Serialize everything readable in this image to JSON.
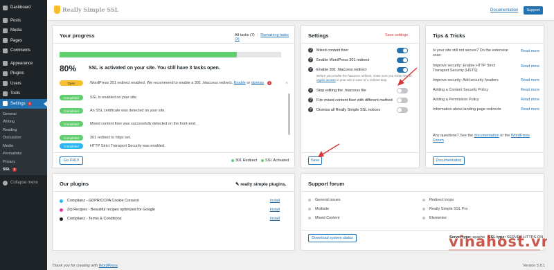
{
  "sidebar": {
    "items": [
      {
        "label": "Dashboard"
      },
      {
        "label": "Posts"
      },
      {
        "label": "Media"
      },
      {
        "label": "Pages"
      },
      {
        "label": "Comments"
      },
      {
        "label": "Appearance"
      },
      {
        "label": "Plugins"
      },
      {
        "label": "Users"
      },
      {
        "label": "Tools"
      }
    ],
    "settings": {
      "label": "Settings",
      "badge": "1"
    },
    "submenu": [
      "General",
      "Writing",
      "Reading",
      "Discussion",
      "Media",
      "Permalinks",
      "Privacy"
    ],
    "ssl": {
      "label": "SSL",
      "badge": "1"
    },
    "collapse": "Collapse menu"
  },
  "header": {
    "logo": "Really Simple SSL",
    "documentation": "Documentation",
    "support": "Support"
  },
  "progress": {
    "title": "Your progress",
    "filter_all": "All tasks (7)",
    "filter_remaining": "Remaining tasks (3)",
    "percent_value": 0.8,
    "percent_label": "80%",
    "status": "SSL is activated on your site. You still have 3 tasks open.",
    "tasks": [
      {
        "status": "Open",
        "pre": "WordPress 301 redirect enabled. We recommend to enable a 301 .htaccess redirect.",
        "link1": "Enable",
        "mid": "or",
        "link2": "dismiss",
        "badge": "1"
      },
      {
        "status": "Completed",
        "text": "SSL is enabled on your site."
      },
      {
        "status": "Completed",
        "text": "An SSL certificate was detected on your site."
      },
      {
        "status": "Completed",
        "text": "Mixed content fixer was successfully detected on the front-end."
      },
      {
        "status": "Completed",
        "text": "301 redirect to https set."
      },
      {
        "status": "Completed",
        "text": "HTTP Strict Transport Security was enabled."
      }
    ],
    "go_pro": "Go PRO!",
    "legend_redirect": "301 Redirect",
    "legend_ssl": "SSL Activated"
  },
  "settings": {
    "title": "Settings",
    "save_link": "Save settings",
    "rows": [
      {
        "label": "Mixed content fixer",
        "on": true
      },
      {
        "label": "Enable WordPress 301 redirect",
        "on": true
      },
      {
        "label": "Enable 301 .htaccess redirect",
        "on": true
      },
      {
        "label": "Stop editing the .htaccess file",
        "on": false
      },
      {
        "label": "Fire mixed content fixer with different method",
        "on": false
      },
      {
        "label": "Dismiss all Really Simple SSL notices",
        "on": false
      }
    ],
    "note_pre": "Before you enable the htaccess redirect, make sure you know how to",
    "note_link": "regain access",
    "note_post": "to your site in case of a redirect loop.",
    "save_button": "Save"
  },
  "tips": {
    "title": "Tips & Tricks",
    "items": [
      "Is your site still not secure? Do the extensive scan",
      "Improve security: Enable HTTP Strict Transport Security (HSTS)",
      "Improve security: Add security headers",
      "Adding a Content Security Policy",
      "Adding a Permission Policy",
      "Information about landing page redirects"
    ],
    "read_more": "Read more",
    "question_pre": "Any questions? See the",
    "question_link1": "documentation",
    "question_mid": "or the",
    "question_link2": "WordPress Forum",
    "doc_button": "Documentation"
  },
  "plugins": {
    "title": "Our plugins",
    "brand": "really simple plugins.",
    "items": [
      {
        "name": "Complianz - GDPR/CCPA Cookie Consent",
        "color": "#29b6f6",
        "action": "Install"
      },
      {
        "name": "Zip Recipes - Beautiful recipes optimized for Google",
        "color": "#e040a0",
        "action": "Install"
      },
      {
        "name": "Complianz - Terms & Conditions",
        "color": "#1d2327",
        "action": "Install"
      }
    ]
  },
  "forum": {
    "title": "Support forum",
    "left": [
      "General issues",
      "Multisite",
      "Mixed Content"
    ],
    "right": [
      "Redirect loops",
      "Really Simple SSL Pro",
      "Elementor"
    ],
    "download": "Download system status",
    "server_label": "Server type:",
    "server_value": "apache",
    "ssl_label": "SSL type:",
    "ssl_value": "SERVER-HTTPS-ON"
  },
  "watermark": {
    "text": "vinahost.vn"
  },
  "footer": {
    "pre": "Thank you for creating with",
    "link": "WordPress",
    "post": ".",
    "version": "Version 5.8.1"
  }
}
